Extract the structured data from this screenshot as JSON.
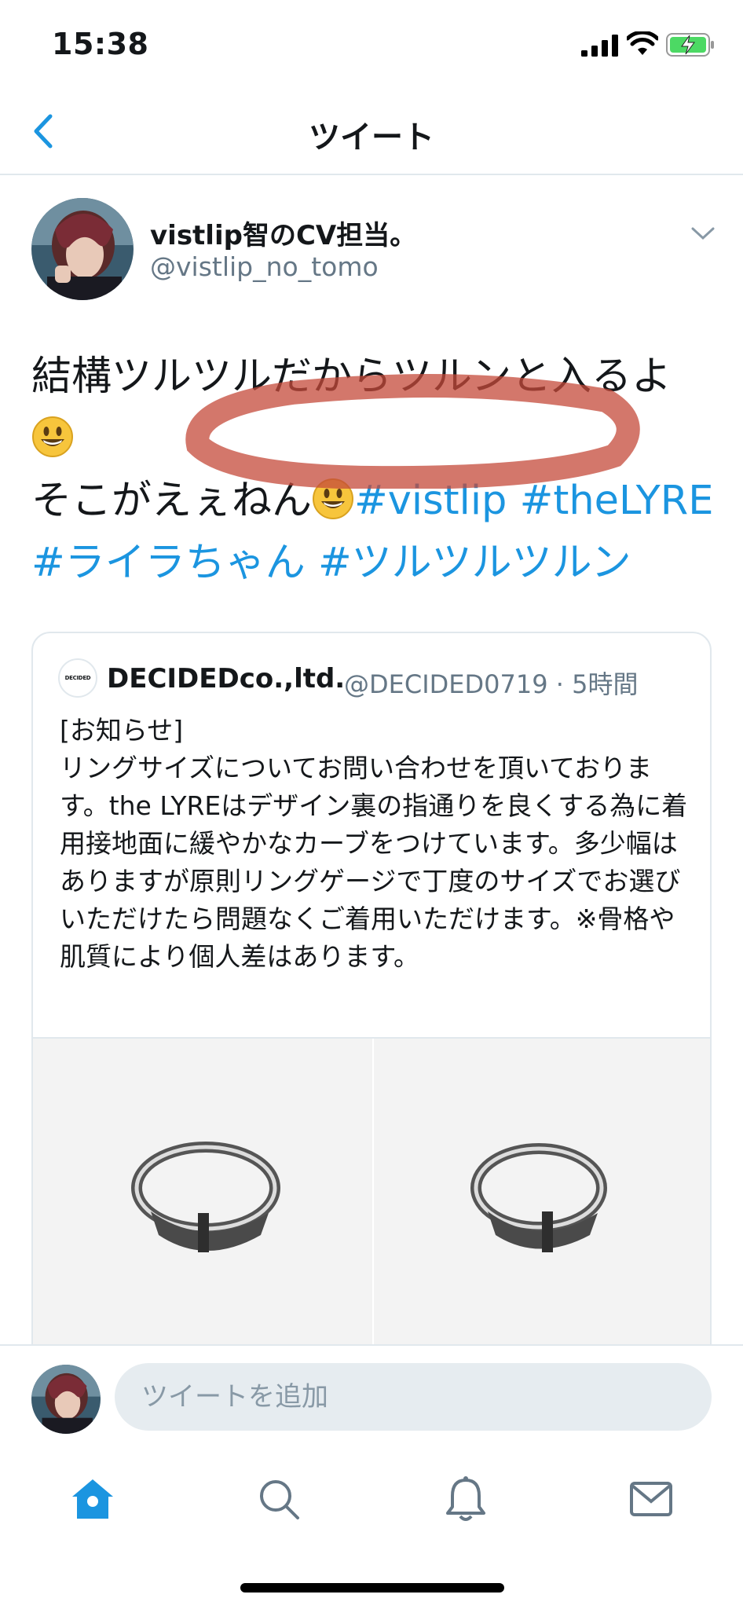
{
  "status_bar": {
    "time": "15:38"
  },
  "nav": {
    "title": "ツイート"
  },
  "tweet": {
    "author_name": "vistlip智のCV担当。",
    "author_handle": "@vistlip_no_tomo",
    "text_line1": "結構ツルツルだからツルンと入るよ",
    "text_line3": "そこがえぇねん",
    "hashtags_line3": "#vistlip #theLYRE",
    "hashtags_line4": "#ライラちゃん #ツルツルツルン"
  },
  "quoted_tweet": {
    "logo_text": "DECIDED",
    "name": "DECIDEDco.,ltd.",
    "handle_time": "@DECIDED0719 · 5時間",
    "text": "[お知らせ]\nリングサイズについてお問い合わせを頂いております。the LYREはデザイン裏の指通りを良くする為に着用接地面に緩やかなカーブをつけています。多少幅はありますが原則リングゲージで丁度のサイズでお選びいただけたら問題なくご着用いただけます。※骨格や肌質により個人差はあります。"
  },
  "reply": {
    "placeholder": "ツイートを追加"
  },
  "tabs": [
    "home-icon",
    "search-icon",
    "notifications-icon",
    "messages-icon"
  ],
  "colors": {
    "accent": "#1b95e0",
    "secondary_text": "#657786",
    "divider": "#e1e8ed",
    "battery_green": "#4cd964",
    "highlight_mark": "#c44a3a"
  }
}
